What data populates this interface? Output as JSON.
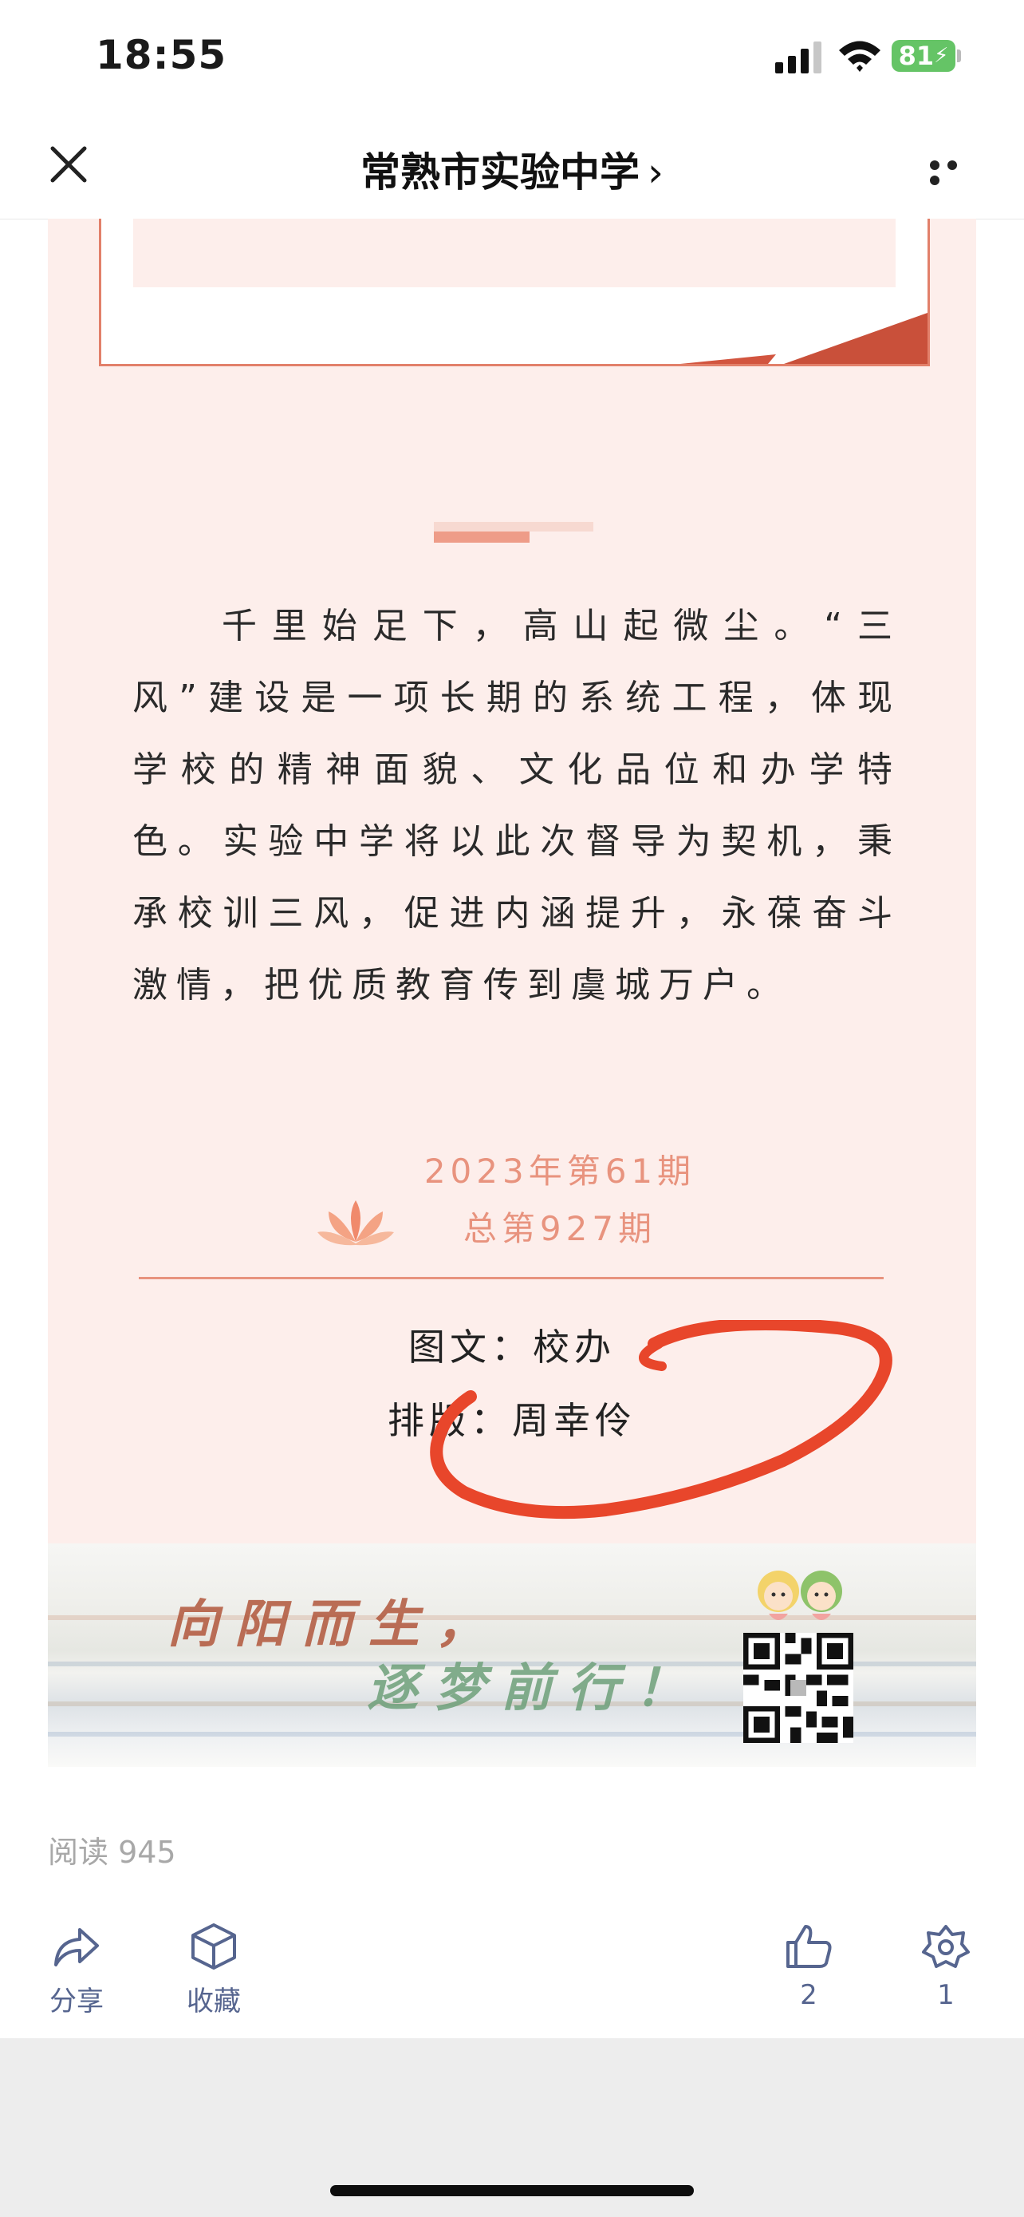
{
  "status_bar": {
    "time": "18:55",
    "battery": "81"
  },
  "nav": {
    "title": "常熟市实验中学",
    "chevron": "›"
  },
  "article": {
    "paragraph": "千里始足下，高山起微尘。“三风”建设是一项长期的系统工程，体现学校的精神面貌、文化品位和办学特色。实验中学将以此次督导为契机，秉承校训三风，促进内涵提升，永葆奋斗激情，把优质教育传到虞城万户。",
    "issue_line1": "2023年第61期",
    "issue_line2": "总第927期",
    "credit_text": "图文：校办",
    "credit_layout": "排版：周幸伶"
  },
  "banner": {
    "line1": "向阳而生，",
    "line2": "逐梦前行！"
  },
  "footer": {
    "read_count": "阅读 945",
    "share_label": "分享",
    "favorite_label": "收藏",
    "like_count": "2",
    "wow_count": "1"
  },
  "colors": {
    "accent": "#e8937e",
    "article_bg": "#fdeeeb",
    "annotation": "#e8462b",
    "action": "#56658f"
  }
}
